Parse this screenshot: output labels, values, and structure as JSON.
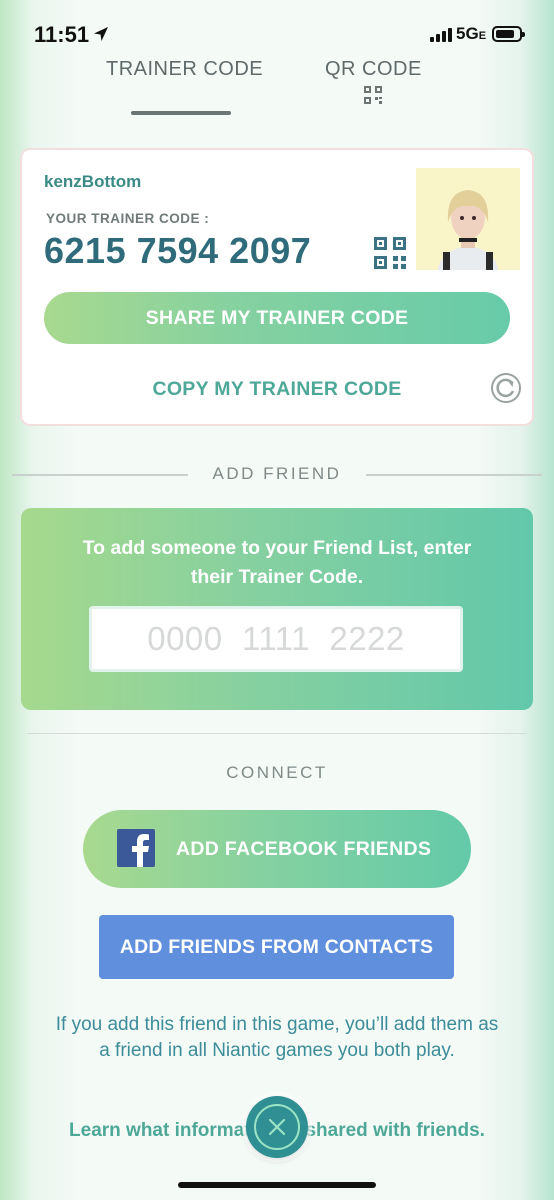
{
  "status_bar": {
    "time": "11:51",
    "network": "5G",
    "network_suffix": "E"
  },
  "tabs": [
    {
      "label": "TRAINER CODE",
      "active": true
    },
    {
      "label": "QR CODE",
      "active": false
    }
  ],
  "trainer_card": {
    "username": "kenzBottom",
    "code_label": "YOUR TRAINER CODE :",
    "code": "6215 7594 2097",
    "share_label": "SHARE MY TRAINER CODE",
    "copy_label": "COPY MY TRAINER CODE"
  },
  "add_friend": {
    "heading": "ADD FRIEND",
    "instructions": "To add someone to your Friend List, enter their Trainer Code.",
    "input_placeholder": "0000  1111  2222",
    "input_value": ""
  },
  "connect": {
    "heading": "CONNECT",
    "facebook_label": "ADD FACEBOOK FRIENDS",
    "contacts_label": "ADD FRIENDS FROM CONTACTS"
  },
  "footer": {
    "info": "If you add this friend in this game, you’ll add them as a friend in all Niantic games you both play.",
    "learn_link": "Learn what information is shared with friends."
  },
  "icons": {
    "location": "location-arrow-icon",
    "qr": "qr-code-icon",
    "refresh": "refresh-icon",
    "facebook": "facebook-icon",
    "close": "close-icon"
  },
  "colors": {
    "accent_teal": "#3a8a86",
    "code_text": "#2f6b7a",
    "gradient_start": "#a8d98f",
    "gradient_end": "#63caa9",
    "contacts_blue": "#5f8fdd",
    "facebook_blue": "#3b5998",
    "close_button": "#2f8f93"
  }
}
